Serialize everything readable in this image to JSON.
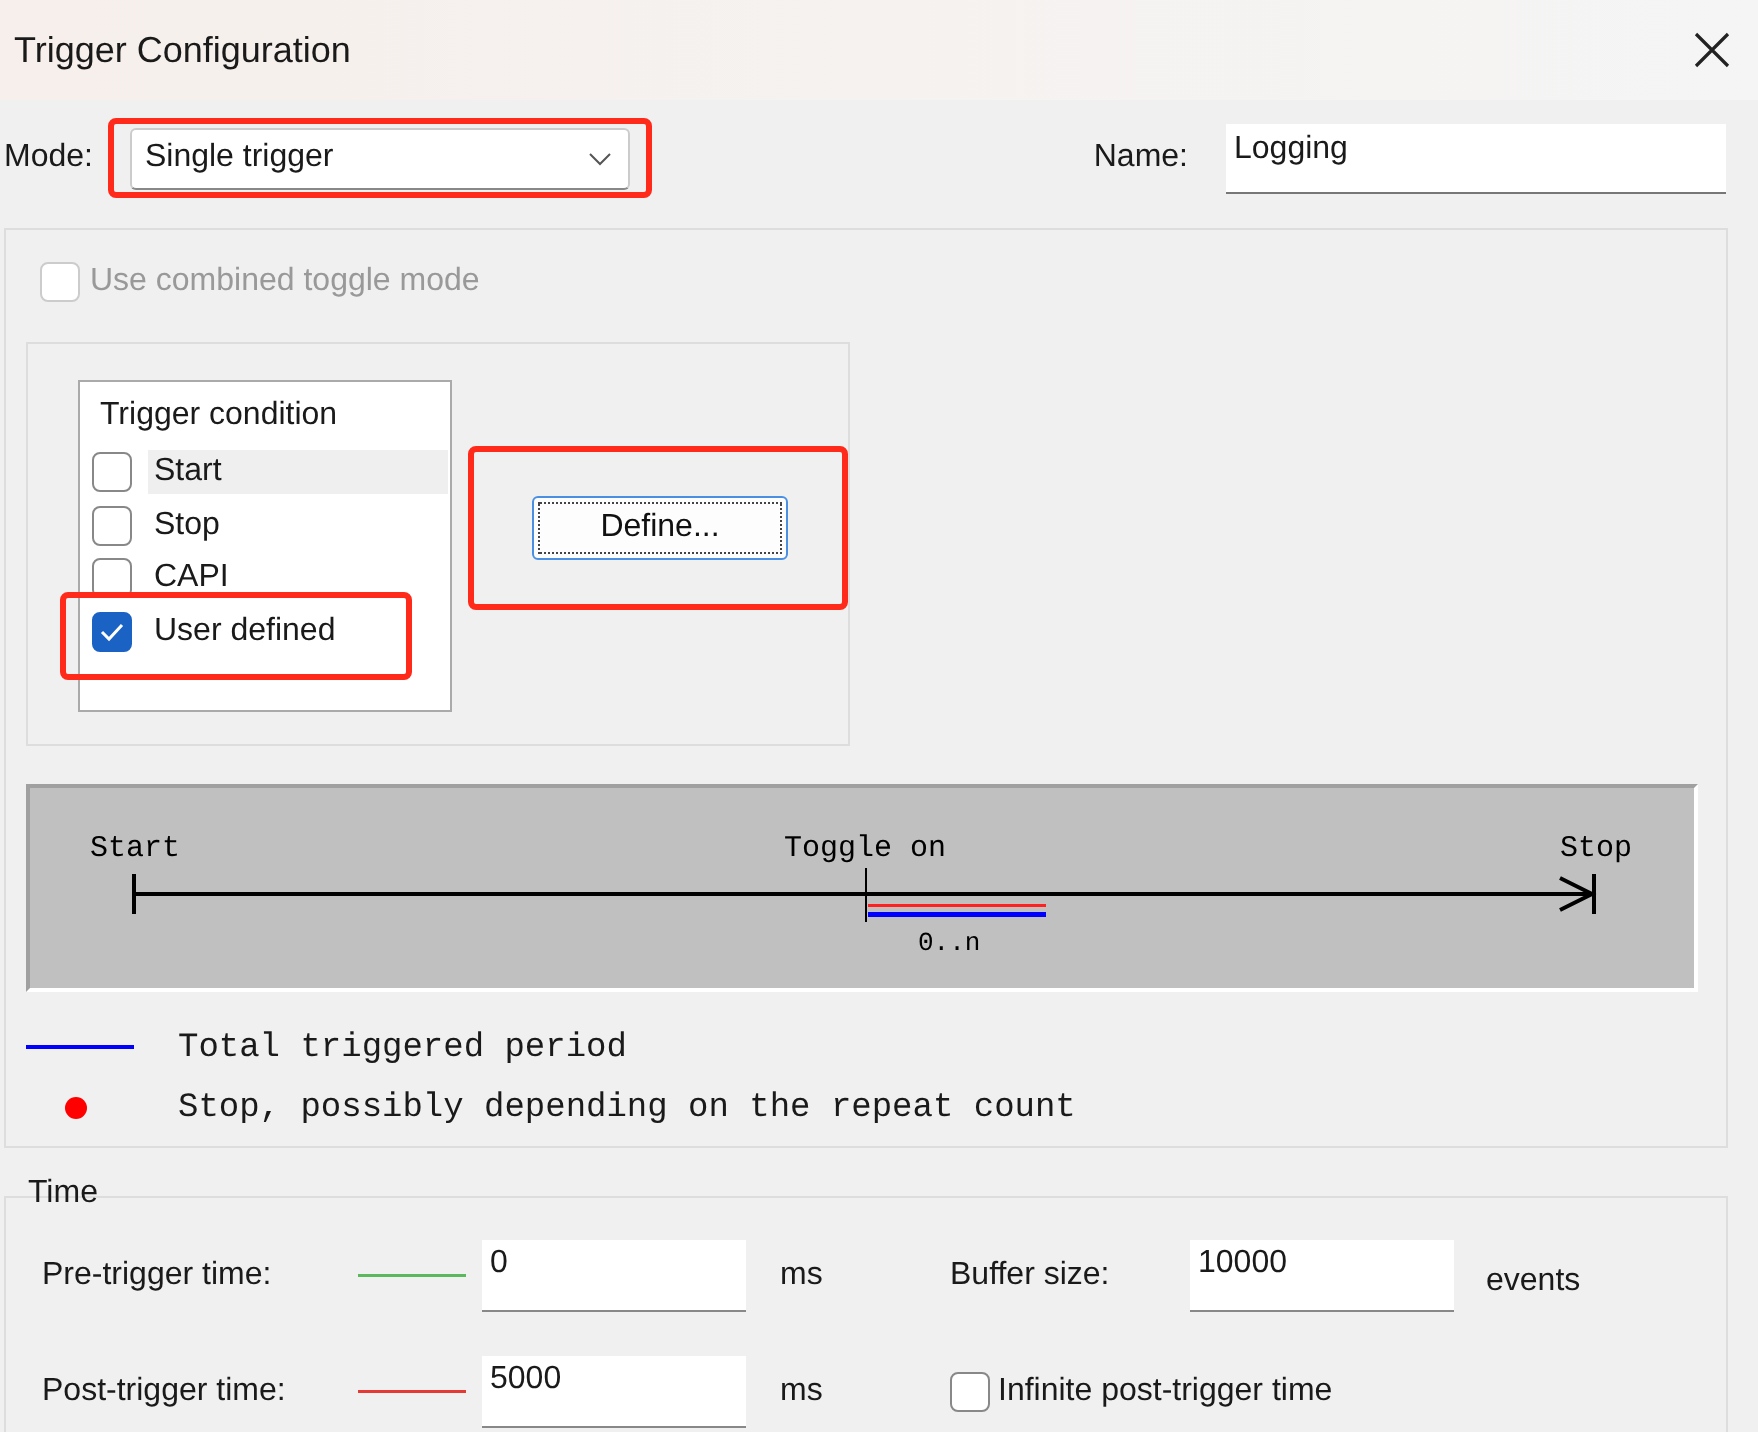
{
  "window": {
    "title": "Trigger Configuration"
  },
  "mode": {
    "label": "Mode:",
    "value": "Single trigger",
    "highlighted": true
  },
  "name": {
    "label": "Name:",
    "value": "Logging"
  },
  "combined_toggle": {
    "label": "Use combined toggle mode",
    "checked": false,
    "disabled": true
  },
  "trigger_condition": {
    "header": "Trigger condition",
    "items": [
      {
        "label": "Start",
        "checked": false,
        "selected": true,
        "highlighted": false
      },
      {
        "label": "Stop",
        "checked": false,
        "selected": false,
        "highlighted": false
      },
      {
        "label": "CAPI",
        "checked": false,
        "selected": false,
        "highlighted": false
      },
      {
        "label": "User defined",
        "checked": true,
        "selected": false,
        "highlighted": true
      }
    ]
  },
  "define_button": {
    "label": "Define...",
    "highlighted": true
  },
  "diagram": {
    "start": "Start",
    "toggle": "Toggle on",
    "stop": "Stop",
    "range": "0..n"
  },
  "legend": [
    {
      "kind": "line",
      "color": "#0000ff",
      "text": "Total triggered period"
    },
    {
      "kind": "dot",
      "color": "#ff0000",
      "text": "Stop, possibly depending on the repeat count"
    }
  ],
  "time": {
    "title": "Time",
    "rows": [
      {
        "label": "Pre-trigger time:",
        "color": "#5cb85c",
        "value": "0",
        "unit": "ms"
      },
      {
        "label": "Post-trigger time:",
        "color": "#e53935",
        "value": "5000",
        "unit": "ms"
      }
    ],
    "buffer": {
      "label": "Buffer size:",
      "value": "10000",
      "unit": "events"
    },
    "infinite": {
      "label": "Infinite post-trigger time",
      "checked": false
    }
  }
}
